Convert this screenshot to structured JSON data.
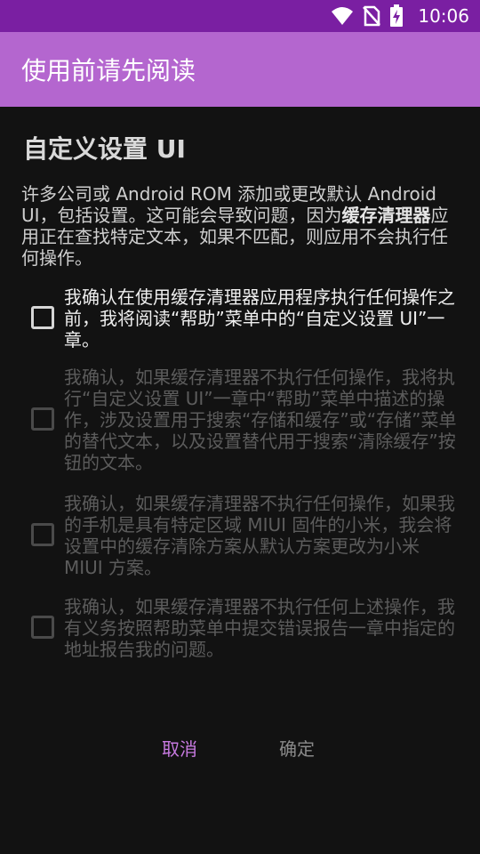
{
  "status_bar": {
    "time": "10:06",
    "icons": [
      "wifi-icon",
      "no-sim-icon",
      "battery-charging-icon"
    ]
  },
  "app_bar": {
    "title": "使用前请先阅读"
  },
  "dialog": {
    "title": "自定义设置 UI",
    "intro_before": "许多公司或 Android ROM 添加或更改默认 Android UI，包括设置。这可能会导致问题，因为",
    "intro_bold": "缓存清理器",
    "intro_after": "应用正在查找特定文本，如果不匹配，则应用不会执行任何操作。",
    "checkboxes": [
      {
        "label": "我确认在使用缓存清理器应用程序执行任何操作之前，我将阅读“帮助”菜单中的“自定义设置 UI”一章。",
        "checked": false,
        "enabled": true
      },
      {
        "label": "我确认，如果缓存清理器不执行任何操作，我将执行“自定义设置 UI”一章中“帮助”菜单中描述的操作，涉及设置用于搜索“存储和缓存”或“存储”菜单的替代文本，以及设置替代用于搜索“清除缓存”按钮的文本。",
        "checked": false,
        "enabled": false
      },
      {
        "label": "我确认，如果缓存清理器不执行任何操作，如果我的手机是具有特定区域 MIUI 固件的小米，我会将设置中的缓存清除方案从默认方案更改为小米 MIUI 方案。",
        "checked": false,
        "enabled": false
      },
      {
        "label": "我确认，如果缓存清理器不执行任何上述操作，我有义务按照帮助菜单中提交错误报告一章中指定的地址报告我的问题。",
        "checked": false,
        "enabled": false
      }
    ],
    "buttons": {
      "cancel": "取消",
      "ok": "确定"
    }
  },
  "colors": {
    "status_bar": "#7a1fa2",
    "app_bar": "#b466cf",
    "background": "#121212",
    "accent": "#c77ae0"
  }
}
